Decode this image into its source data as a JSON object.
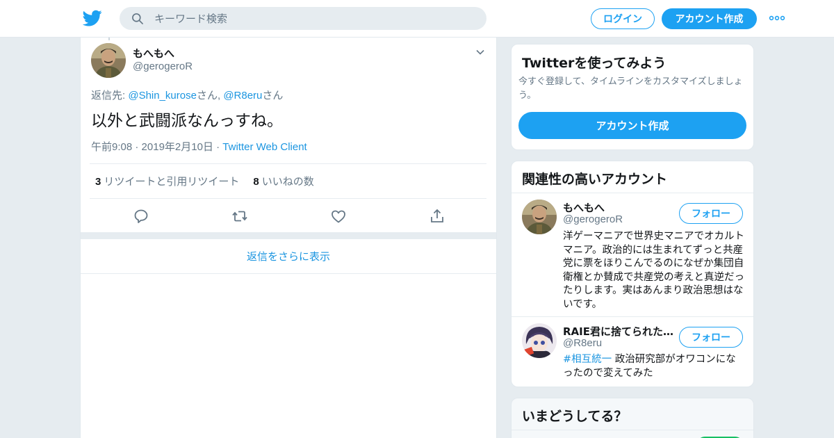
{
  "header": {
    "search_placeholder": "キーワード検索",
    "login_label": "ログイン",
    "signup_label": "アカウント作成",
    "brand_color": "#1da1f2"
  },
  "tweet": {
    "display_name": "もへもへ",
    "handle": "@gerogeroR",
    "reply_prefix": "返信先: ",
    "reply_user1": "@Shin_kurose",
    "reply_san1": "さん, ",
    "reply_user2": "@R8eru",
    "reply_san2": "さん",
    "text": "以外と武闘派なんっすね。",
    "time": "午前9:08",
    "date": "2019年2月10日",
    "client": "Twitter Web Client",
    "retweet_count": "3",
    "retweet_label": "リツイートと引用リツイート",
    "like_count": "8",
    "like_label": "いいねの数",
    "more_replies": "返信をさらに表示"
  },
  "sidebar": {
    "try": {
      "title": "Twitterを使ってみよう",
      "subtitle": "今すぐ登録して、タイムラインをカスタマイズしましょう。",
      "cta": "アカウント作成"
    },
    "related": {
      "title": "関連性の高いアカウント",
      "accounts": [
        {
          "name": "もへもへ",
          "handle": "@gerogeroR",
          "bio": "洋ゲーマニアで世界史マニアでオカルトマニア。政治的には生まれてずっと共産党に票をほりこんでるのになぜか集団自衛権とか賛成で共産党の考えと真逆だったりします。実はあんまり政治思想はないです。",
          "follow_label": "フォロー"
        },
        {
          "name": "RAIE君に捨てられた…",
          "handle": "@R8eru",
          "bio_tag": "#相互統一",
          "bio": " 政治研究部がオワコンになったので変えてみた",
          "follow_label": "フォロー"
        }
      ]
    },
    "now": {
      "title": "いまどうしてる？"
    }
  }
}
